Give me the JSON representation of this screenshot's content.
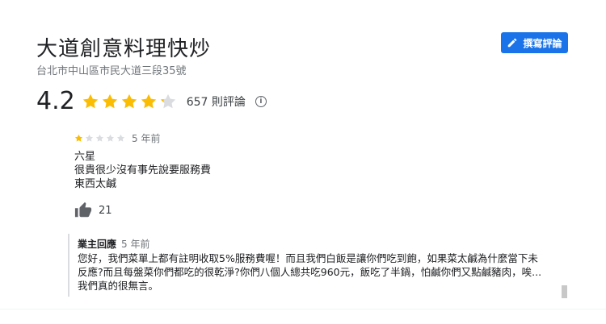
{
  "place": {
    "name": "大道創意料理快炒",
    "address": "台北市中山區市民大道三段35號"
  },
  "write_review_label": "撰寫評論",
  "rating": {
    "value": "4.2",
    "stars": 4.2,
    "review_count": "657 則評論"
  },
  "review": {
    "stars": 1,
    "time": "5 年前",
    "lines": [
      "六星",
      "很貴很少沒有事先說要服務費",
      "東西太鹹"
    ],
    "likes": "21"
  },
  "owner_reply": {
    "label": "業主回應",
    "time": "5 年前",
    "lines": [
      "您好，我們菜單上都有註明收取5%服務費喔！而且我們白飯是讓你們吃到飽，如果菜太鹹為什麼當下未",
      "反應?而且每盤菜你們都吃的很乾淨?你們八個人總共吃960元，飯吃了半鍋，怕鹹你們又點鹹豬肉，唉...",
      "我們真的很無言。"
    ]
  },
  "colors": {
    "accent": "#1a73e8",
    "star_filled": "#fbbc04",
    "star_empty": "#dadce0"
  },
  "icons": {
    "write": "pencil-icon",
    "info": "info-icon",
    "like": "thumbs-up-icon"
  }
}
